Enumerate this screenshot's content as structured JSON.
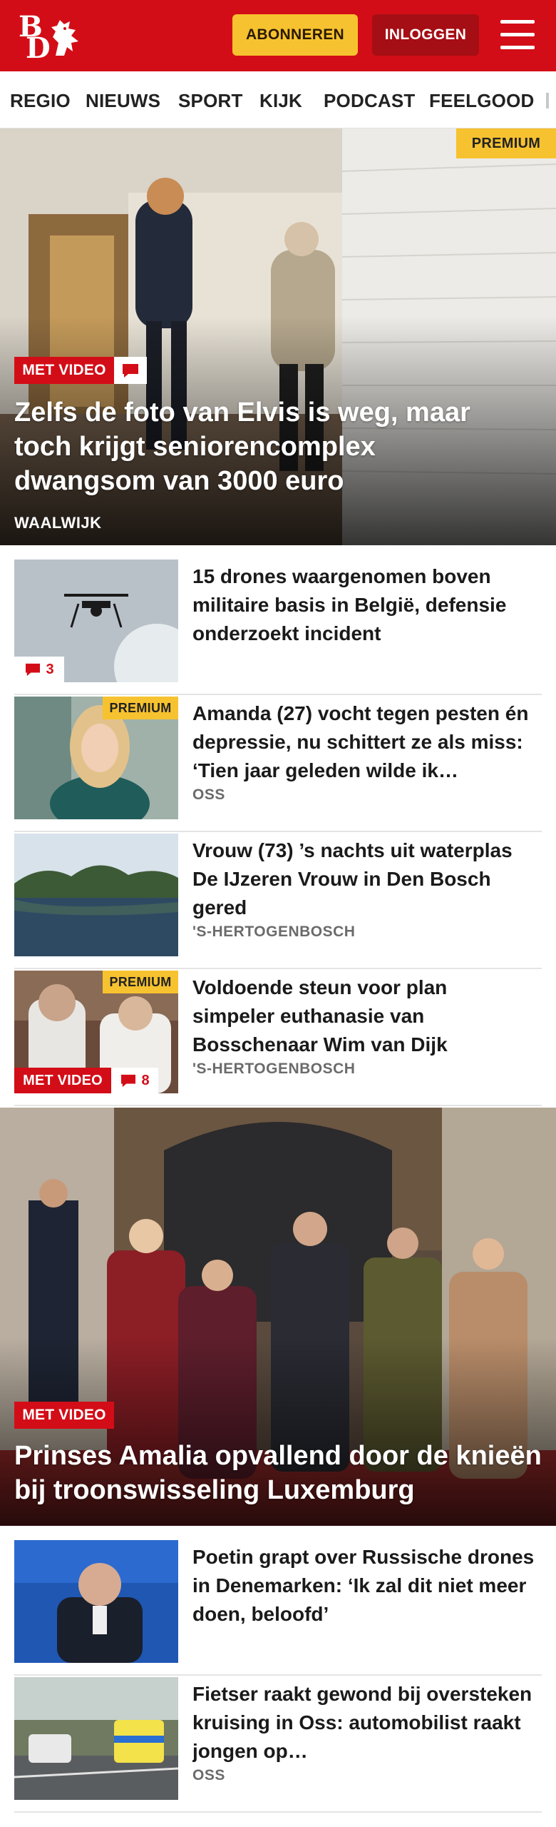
{
  "header": {
    "logo_top": "B",
    "logo_bottom": "D",
    "subscribe_label": "ABONNEREN",
    "login_label": "INLOGGEN"
  },
  "nav": {
    "items": [
      "REGIO",
      "NIEUWS",
      "SPORT",
      "KIJK",
      "PODCAST",
      "FEELGOOD"
    ]
  },
  "hero1": {
    "premium": "PREMIUM",
    "video_label": "MET VIDEO",
    "title": "Zelfs de foto van Elvis is weg, maar toch krijgt seniorencomplex dwangsom van 3000 euro",
    "location": "WAALWIJK"
  },
  "articles": [
    {
      "title": "15 drones waargenomen boven militaire basis in België, defensie onderzoekt incident",
      "comments": "3"
    },
    {
      "title": "Amanda (27) vocht tegen pesten én depressie, nu schittert ze als miss: ‘Tien jaar geleden wilde ik…",
      "location": "OSS",
      "premium": "PREMIUM"
    },
    {
      "title": "Vrouw (73) ’s nachts uit waterplas De IJzeren Vrouw in Den Bosch gered",
      "location": "'S-HERTOGENBOSCH"
    },
    {
      "title": "Voldoende steun voor plan simpeler euthanasie van Bosschenaar Wim van Dijk",
      "location": "'S-HERTOGENBOSCH",
      "premium": "PREMIUM",
      "video_label": "MET VIDEO",
      "comments": "8"
    }
  ],
  "hero2": {
    "video_label": "MET VIDEO",
    "title": "Prinses Amalia opvallend door de knieën bij troonswisseling Luxemburg"
  },
  "articles2": [
    {
      "title": "Poetin grapt over Russische drones in Denemarken: ‘Ik zal dit niet meer doen, beloofd’"
    },
    {
      "title": "Fietser raakt gewond bij oversteken kruising in Oss: automobilist raakt jongen op…",
      "location": "OSS"
    }
  ],
  "colors": {
    "brand_red": "#d30d17",
    "premium_yellow": "#f7c22f",
    "login_dark_red": "#a50e14"
  },
  "icons": [
    "bd-logo",
    "menu-icon",
    "comment-icon"
  ]
}
